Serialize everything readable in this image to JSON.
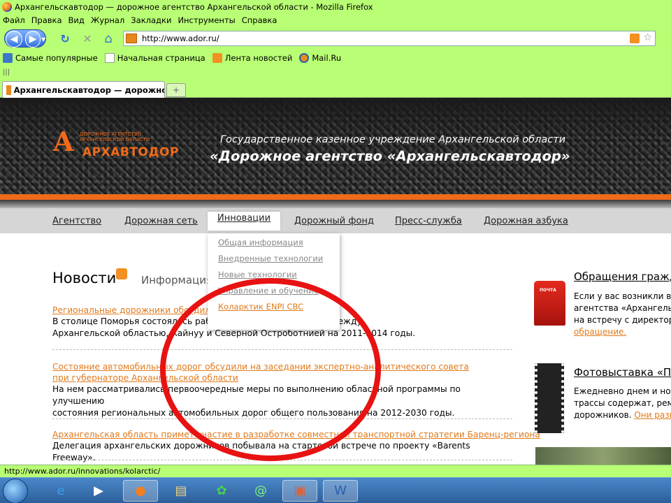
{
  "window": {
    "title": "Архангельскавтодор — дорожное агентство Архангельской области - Mozilla Firefox"
  },
  "menu": [
    "Файл",
    "Правка",
    "Вид",
    "Журнал",
    "Закладки",
    "Инструменты",
    "Справка"
  ],
  "toolbar": {
    "url": "http://www.ador.ru/",
    "back_label": "◀",
    "forward_label": "▶",
    "reload_label": "↻",
    "stop_label": "✕",
    "home_label": "⌂"
  },
  "bookmarks": [
    "Самые популярные",
    "Начальная страница",
    "Лента новостей",
    "Mail.Ru"
  ],
  "tabs": [
    {
      "label": "Архангельскавтодор — дорожное агентство Архангельской области"
    }
  ],
  "new_tab_label": "+",
  "header": {
    "logo_small": "ДОРОЖНОЕ АГЕНТСТВО АРХАНГЕЛЬСКОЙ ОБЛАСТИ",
    "logo_main": "АРХАВТОДОР",
    "logo_mark": "A",
    "subtitle": "Государственное казенное учреждение Архангельской области",
    "title": "«Дорожное агентство «Архангельскавтодор»"
  },
  "nav": {
    "items": [
      "Агентство",
      "Дорожная сеть",
      "Инновации",
      "Дорожный фонд",
      "Пресс-служба",
      "Дорожная азбука"
    ],
    "active_index": 2
  },
  "dropdown": {
    "items": [
      "Общая информация",
      "Внедренные технологии",
      "Новые технологии",
      "Управление и обучение",
      "Коларктик ENPI CBC"
    ],
    "highlighted_index": 4
  },
  "news": {
    "title": "Новости",
    "info_tab": "Информация",
    "items": [
      {
        "link": "Региональные дорожники обсудили ... с Финляндией",
        "text_lines": [
          "В столице Поморья состоялась рабо... ...ия о сотрудничестве между",
          "Архангельской областью, Кайнуу и Северной Остроботнией на 2011-2014 годы."
        ]
      },
      {
        "link_lines": [
          "Состояние автомобильных дорог обсудили на заседании экспертно-аналитического совета",
          "при губернаторе Архангельской области"
        ],
        "text_lines": [
          "На нем рассматривались первоочередные меры по выполнению областной программы по улучшению",
          "состояния региональных автомобильных дорог общего пользования на 2012-2030 годы."
        ]
      },
      {
        "link": "Архангельская область примет участие в разработке совместной транспортной стратегии Баренц-региона",
        "text_lines": [
          "Делегация архангельских дорожников побывала на стартовой встрече по проекту «Barents Freeway»."
        ]
      }
    ]
  },
  "sidebar": {
    "appeals": {
      "title": "Обращения гражд",
      "lines": [
        "Если у вас возникли во",
        "агентства «Архангельс",
        "на встречу с директоро"
      ],
      "link": "обращение.",
      "mailbox_label": "ПОЧТА"
    },
    "photo": {
      "title": "Фотовыставка «Пр",
      "lines": [
        "Ежедневно днем и ноч",
        "трассы содержат, реме",
        "дорожников."
      ],
      "link": "Они разн"
    }
  },
  "status": {
    "url": "http://www.ador.ru/innovations/kolarctic/"
  },
  "taskbar": {
    "icons": [
      "windows-start",
      "internet-explorer",
      "media-player",
      "firefox",
      "explorer-folder",
      "icq",
      "mail-agent",
      "powerpoint",
      "word"
    ]
  },
  "colors": {
    "chrome_bg": "#b9ff75",
    "accent_orange": "#e07a1c",
    "annotation_red": "#e81212"
  }
}
